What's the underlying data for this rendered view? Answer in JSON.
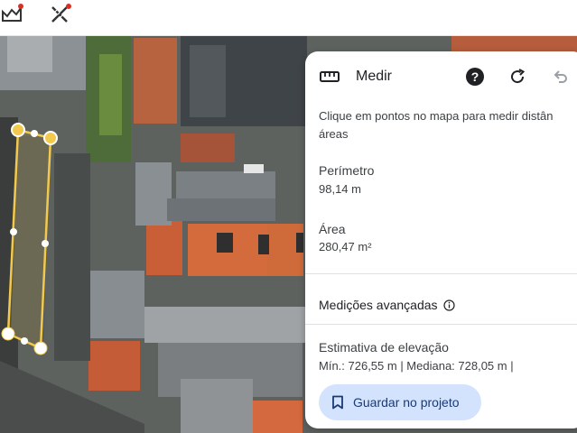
{
  "toolbar": {
    "tools": [
      {
        "icon": "terrain-chart-icon",
        "badge_color": "#d93025"
      },
      {
        "icon": "measure-tools-icon",
        "badge_color": "#d93025"
      }
    ]
  },
  "panel": {
    "title": "Medir",
    "instruction_line1": "Clique em pontos no mapa para medir distân",
    "instruction_line2": "áreas",
    "perimeter": {
      "label": "Perímetro",
      "value": "98,14 m"
    },
    "area": {
      "label": "Área",
      "value": "280,47 m²"
    },
    "advanced_label": "Medições avançadas",
    "elevation": {
      "label": "Estimativa de elevação",
      "stats": "Mín.: 726,55 m | Mediana: 728,05 m |"
    },
    "save_label": "Guardar no projeto"
  },
  "colors": {
    "accent_button": "#d3e3fd",
    "measurement_line": "#f2c94c"
  }
}
